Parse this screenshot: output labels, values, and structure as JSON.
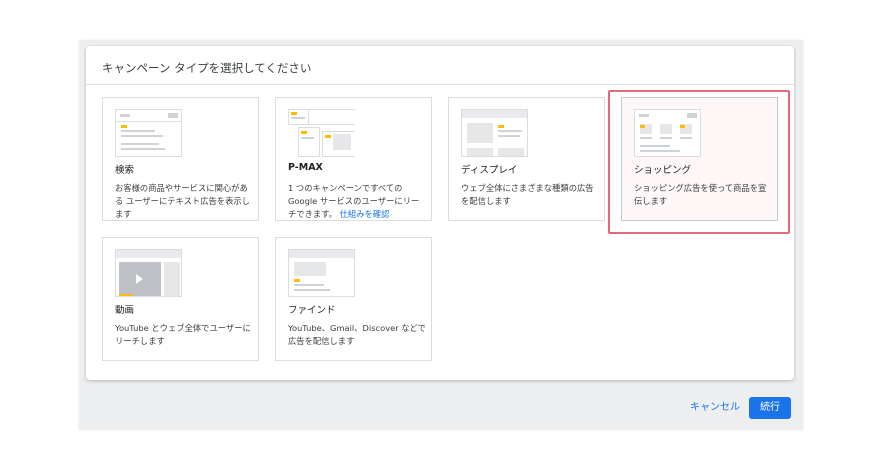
{
  "dialog": {
    "title": "キャンペーン タイプを選択してください",
    "cancel_label": "キャンセル",
    "continue_label": "続行"
  },
  "campaign_types": [
    {
      "title": "検索",
      "description": "お客様の商品やサービスに関心がある ユーザーにテキスト広告を表示します"
    },
    {
      "title": "P-MAX",
      "description": "1 つのキャンペーンですべての Google サービスのユーザーにリーチできます。",
      "link": "仕組みを確認"
    },
    {
      "title": "ディスプレイ",
      "description": "ウェブ全体にさまざまな種類の広告を配信します"
    },
    {
      "title": "ショッピング",
      "description": "ショッピング広告を使って商品を宣伝します",
      "selected": true
    },
    {
      "title": "動画",
      "description": "YouTube とウェブ全体でユーザーにリーチします"
    },
    {
      "title": "ファインド",
      "description": "YouTube、Gmail、Discover などで広告を配信します"
    }
  ],
  "colors": {
    "accent": "#1a73e8",
    "highlight": "#e06a7b",
    "illustration_yellow": "#fbbc04"
  }
}
